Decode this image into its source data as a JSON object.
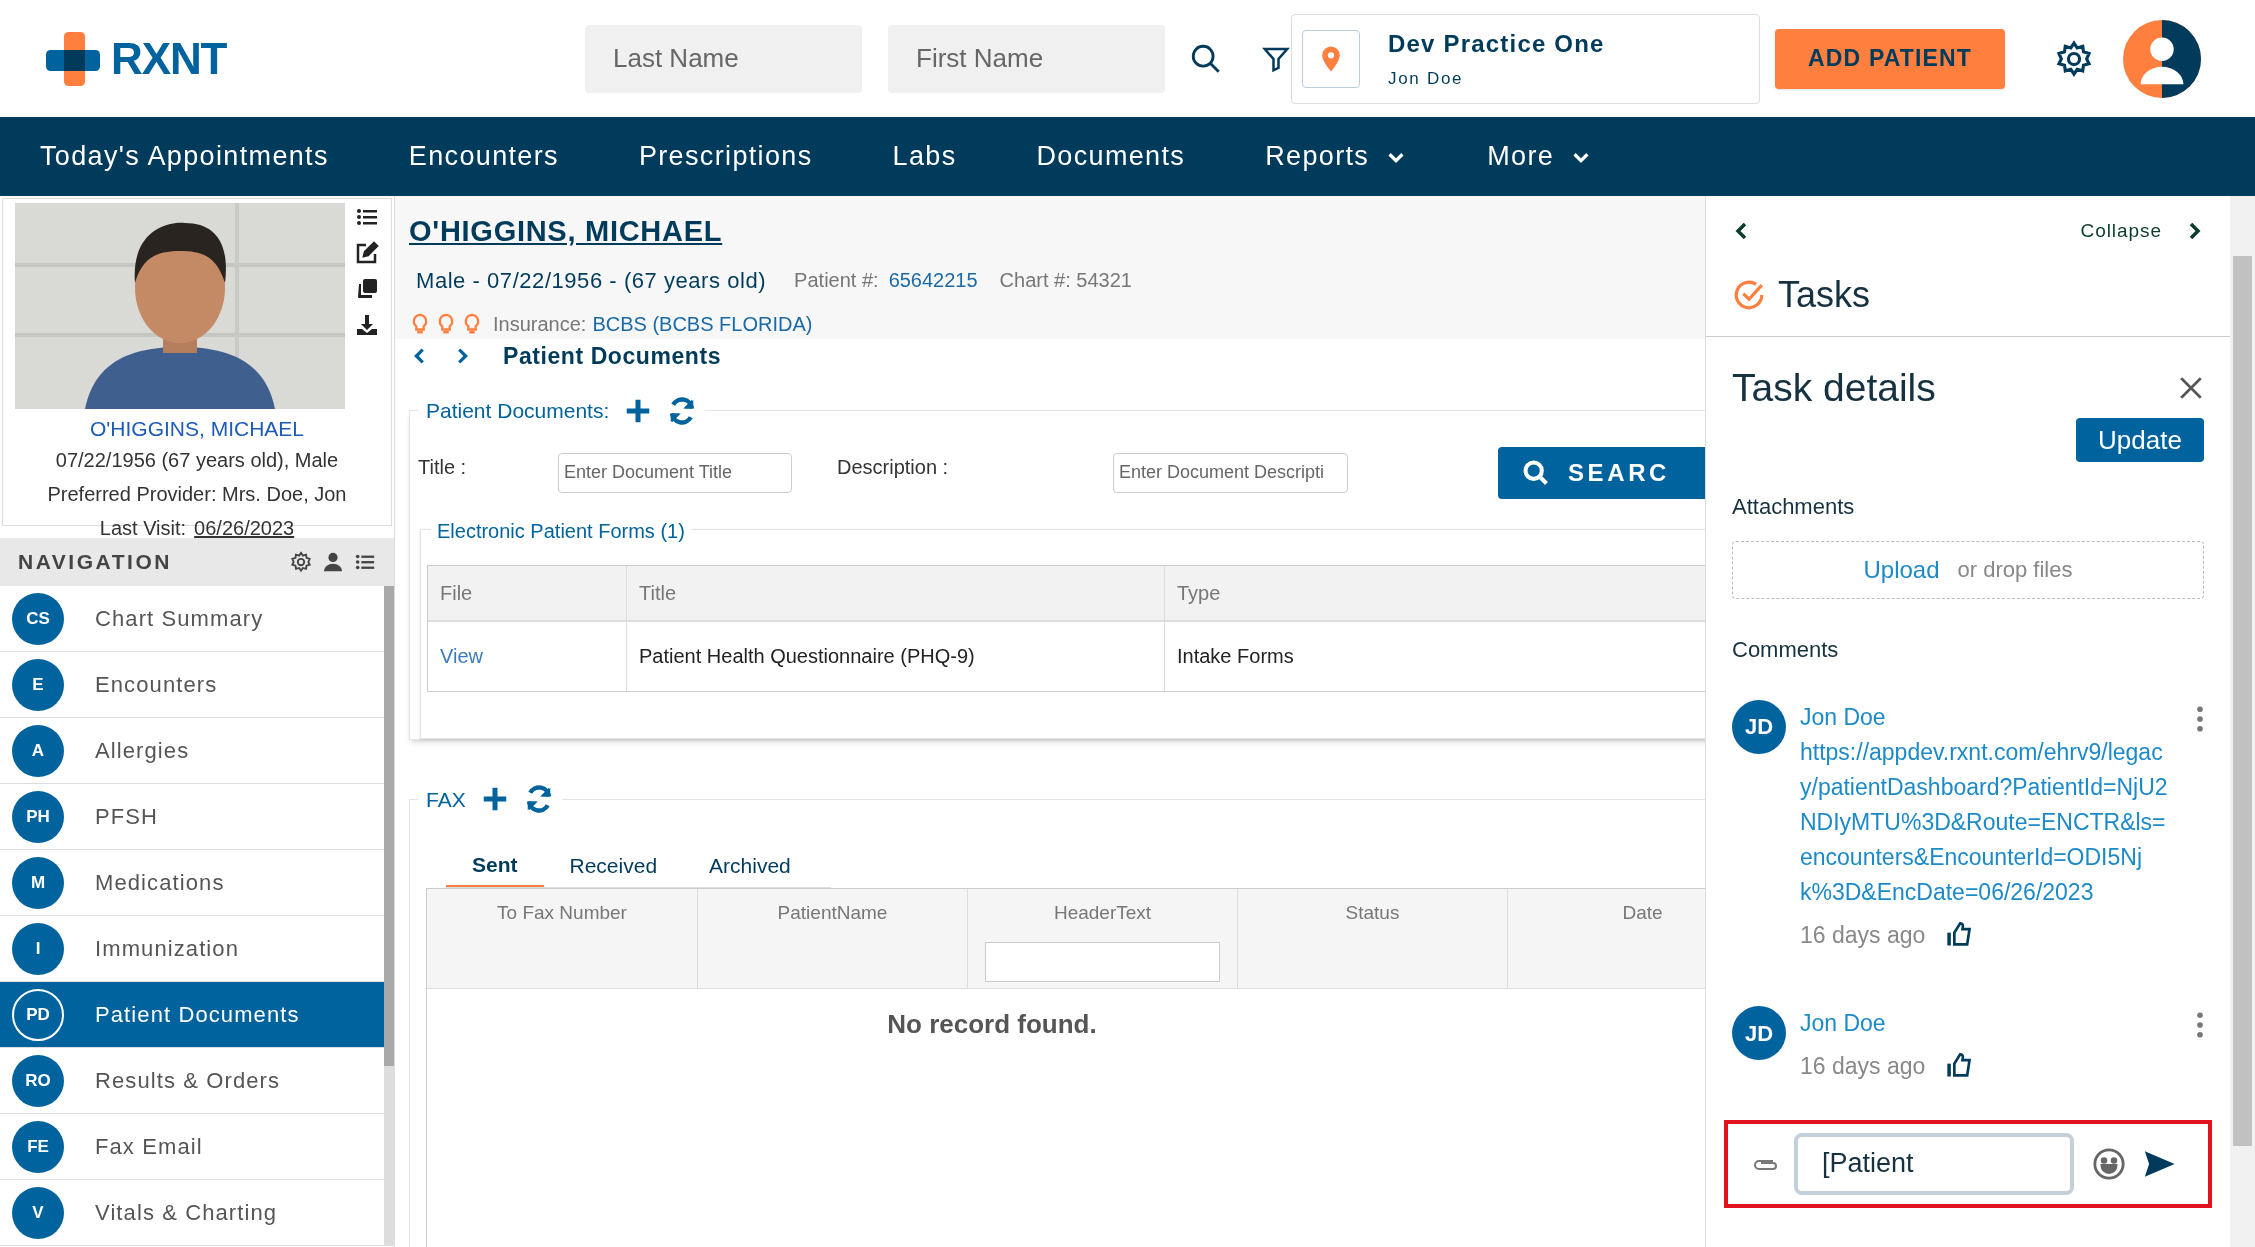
{
  "header": {
    "logo": "RXNT",
    "last_name": {
      "placeholder": "Last Name"
    },
    "first_name": {
      "placeholder": "First Name"
    },
    "practice": {
      "name": "Dev Practice One",
      "user": "Jon Doe"
    },
    "add_patient": "ADD PATIENT"
  },
  "main_menu": [
    {
      "label": "Today's Appointments",
      "dropdown": false
    },
    {
      "label": "Encounters",
      "dropdown": false
    },
    {
      "label": "Prescriptions",
      "dropdown": false
    },
    {
      "label": "Labs",
      "dropdown": false
    },
    {
      "label": "Documents",
      "dropdown": false
    },
    {
      "label": "Reports",
      "dropdown": true
    },
    {
      "label": "More",
      "dropdown": true
    }
  ],
  "patient_card": {
    "name": "O'HIGGINS, MICHAEL",
    "birth": "07/22/1956 (67 years old), Male",
    "provider": "Preferred Provider: Mrs. Doe, Jon",
    "last_visit_label": "Last Visit:",
    "last_visit": "06/26/2023"
  },
  "navigation": {
    "title": "NAVIGATION",
    "items": [
      {
        "abbr": "CS",
        "label": "Chart Summary",
        "selected": false
      },
      {
        "abbr": "E",
        "label": "Encounters",
        "selected": false
      },
      {
        "abbr": "A",
        "label": "Allergies",
        "selected": false
      },
      {
        "abbr": "PH",
        "label": "PFSH",
        "selected": false
      },
      {
        "abbr": "M",
        "label": "Medications",
        "selected": false
      },
      {
        "abbr": "I",
        "label": "Immunization",
        "selected": false
      },
      {
        "abbr": "PD",
        "label": "Patient Documents",
        "selected": true
      },
      {
        "abbr": "RO",
        "label": "Results & Orders",
        "selected": false
      },
      {
        "abbr": "FE",
        "label": "Fax Email",
        "selected": false
      },
      {
        "abbr": "V",
        "label": "Vitals & Charting",
        "selected": false
      }
    ]
  },
  "patient_header": {
    "name": "O'HIGGINS, MICHAEL",
    "demographics": "Male - 07/22/1956 - (67 years old)",
    "patient_label": "Patient #:",
    "patient_number": "65642215",
    "chart": "Chart #: 54321",
    "insurance_label": "Insurance:",
    "insurance": "BCBS (BCBS FLORIDA)"
  },
  "breadcrumb": "Patient Documents",
  "documents": {
    "legend": "Patient Documents:",
    "title_label": "Title :",
    "title_field": {
      "placeholder": "Enter Document Title"
    },
    "description_label": "Description :",
    "description_field": {
      "placeholder": "Enter Document Descripti"
    },
    "search_button": "SEARC",
    "forms": {
      "legend": "Electronic Patient Forms (1)",
      "columns": [
        "File",
        "Title",
        "Type"
      ],
      "rows": [
        [
          "View",
          "Patient Health Questionnaire (PHQ-9)",
          "Intake Forms"
        ]
      ]
    }
  },
  "fax": {
    "legend": "FAX",
    "tabs": [
      {
        "label": "Sent",
        "selected": true
      },
      {
        "label": "Received",
        "selected": false
      },
      {
        "label": "Archived",
        "selected": false
      }
    ],
    "columns": [
      {
        "label": "To Fax Number",
        "filter": false
      },
      {
        "label": "PatientName",
        "filter": false
      },
      {
        "label": "HeaderText",
        "filter": true
      },
      {
        "label": "Status",
        "filter": false
      },
      {
        "label": "Date",
        "filter": false
      }
    ],
    "empty": "No record found."
  },
  "tasks": {
    "collapse": "Collapse",
    "title": "Tasks",
    "details_title": "Task details",
    "update_button": "Update",
    "attachments": "Attachments",
    "upload": "Upload",
    "drop": "or drop files",
    "comments_label": "Comments",
    "comments": [
      {
        "initials": "JD",
        "author": "Jon Doe",
        "body": "https://appdev.rxnt.com/ehrv9/legacy/patientDashboard?PatientId=NjU2NDIyMTU%3D&Route=ENCTR&ls=encounters&EncounterId=ODI5Njk%3D&EncDate=06/26/2023",
        "time": "16 days ago"
      },
      {
        "initials": "JD",
        "author": "Jon Doe",
        "time": "16 days ago"
      }
    ],
    "composer": {
      "value": "[Patient"
    }
  }
}
